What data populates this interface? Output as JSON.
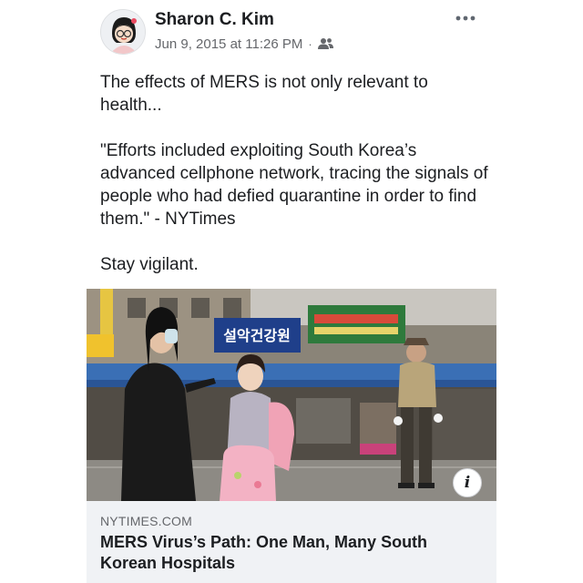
{
  "post": {
    "author": "Sharon C. Kim",
    "timestamp": "Jun 9, 2015 at 11:26 PM",
    "separator": "·",
    "audience_icon": "friends-icon",
    "more_icon": "more-options-icon",
    "text": {
      "line1": "The effects of MERS is not only relevant to health...",
      "quote": "\"Efforts included exploiting South Korea’s advanced cellphone network, tracing the signals of people who had defied quarantine in order to find them.\" - NYTimes",
      "closing": "Stay vigilant."
    },
    "link_preview": {
      "image_sign_text": "설악건강원",
      "domain": "NYTIMES.COM",
      "headline": "MERS Virus’s Path: One Man, Many South Korean Hospitals",
      "info_icon": "info-icon",
      "info_glyph": "i"
    }
  }
}
